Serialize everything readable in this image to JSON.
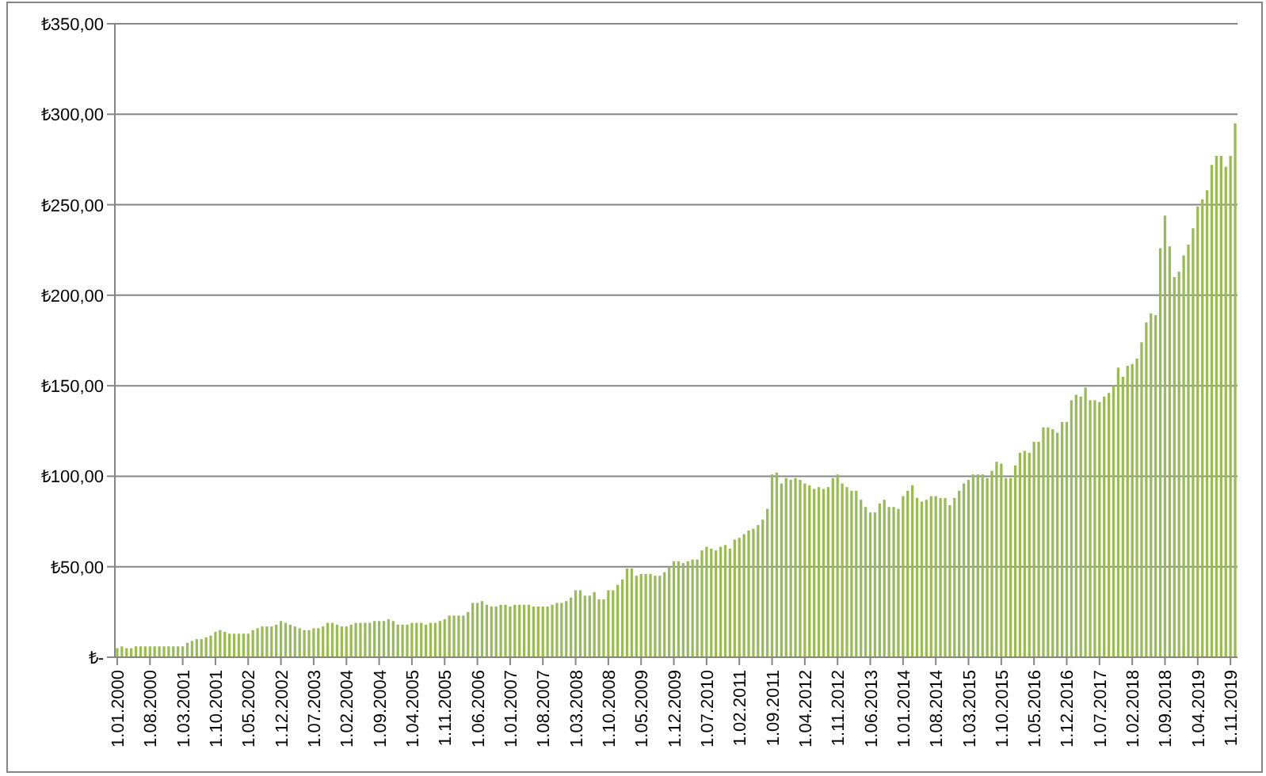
{
  "chart_data": {
    "type": "bar",
    "color": "#9bbb59",
    "yticks": [
      {
        "value": 0,
        "label": "₺-"
      },
      {
        "value": 50,
        "label": "₺50,00"
      },
      {
        "value": 100,
        "label": "₺100,00"
      },
      {
        "value": 150,
        "label": "₺150,00"
      },
      {
        "value": 200,
        "label": "₺200,00"
      },
      {
        "value": 250,
        "label": "₺250,00"
      },
      {
        "value": 300,
        "label": "₺300,00"
      },
      {
        "value": 350,
        "label": "₺350,00"
      }
    ],
    "ylim": [
      0,
      350
    ],
    "grid": true,
    "categories": [
      "1.01.2000",
      null,
      null,
      null,
      null,
      null,
      null,
      "1.08.2000",
      null,
      null,
      null,
      null,
      null,
      null,
      "1.03.2001",
      null,
      null,
      null,
      null,
      null,
      null,
      "1.10.2001",
      null,
      null,
      null,
      null,
      null,
      null,
      "1.05.2002",
      null,
      null,
      null,
      null,
      null,
      null,
      "1.12.2002",
      null,
      null,
      null,
      null,
      null,
      null,
      "1.07.2003",
      null,
      null,
      null,
      null,
      null,
      null,
      "1.02.2004",
      null,
      null,
      null,
      null,
      null,
      null,
      "1.09.2004",
      null,
      null,
      null,
      null,
      null,
      null,
      "1.04.2005",
      null,
      null,
      null,
      null,
      null,
      null,
      "1.11.2005",
      null,
      null,
      null,
      null,
      null,
      null,
      "1.06.2006",
      null,
      null,
      null,
      null,
      null,
      null,
      "1.01.2007",
      null,
      null,
      null,
      null,
      null,
      null,
      "1.08.2007",
      null,
      null,
      null,
      null,
      null,
      null,
      "1.03.2008",
      null,
      null,
      null,
      null,
      null,
      null,
      "1.10.2008",
      null,
      null,
      null,
      null,
      null,
      null,
      "1.05.2009",
      null,
      null,
      null,
      null,
      null,
      null,
      "1.12.2009",
      null,
      null,
      null,
      null,
      null,
      null,
      "1.07.2010",
      null,
      null,
      null,
      null,
      null,
      null,
      "1.02.2011",
      null,
      null,
      null,
      null,
      null,
      null,
      "1.09.2011",
      null,
      null,
      null,
      null,
      null,
      null,
      "1.04.2012",
      null,
      null,
      null,
      null,
      null,
      null,
      "1.11.2012",
      null,
      null,
      null,
      null,
      null,
      null,
      "1.06.2013",
      null,
      null,
      null,
      null,
      null,
      null,
      "1.01.2014",
      null,
      null,
      null,
      null,
      null,
      null,
      "1.08.2014",
      null,
      null,
      null,
      null,
      null,
      null,
      "1.03.2015",
      null,
      null,
      null,
      null,
      null,
      null,
      "1.10.2015",
      null,
      null,
      null,
      null,
      null,
      null,
      "1.05.2016",
      null,
      null,
      null,
      null,
      null,
      null,
      "1.12.2016",
      null,
      null,
      null,
      null,
      null,
      null,
      "1.07.2017",
      null,
      null,
      null,
      null,
      null,
      null,
      "1.02.2018",
      null,
      null,
      null,
      null,
      null,
      null,
      "1.09.2018",
      null,
      null,
      null,
      null,
      null,
      null,
      "1.04.2019",
      null,
      null,
      null,
      null,
      null,
      null,
      "1.11.2019",
      null
    ],
    "values": [
      5,
      6,
      5,
      5,
      6,
      6,
      6,
      6,
      6,
      6,
      6,
      6,
      6,
      6,
      6,
      8,
      9,
      10,
      10,
      11,
      12,
      14,
      15,
      14,
      13,
      13,
      13,
      13,
      13,
      15,
      16,
      17,
      17,
      17,
      18,
      20,
      19,
      18,
      17,
      16,
      15,
      15,
      16,
      16,
      17,
      19,
      19,
      18,
      17,
      17,
      18,
      19,
      19,
      19,
      19,
      20,
      20,
      20,
      21,
      20,
      18,
      18,
      18,
      19,
      19,
      19,
      18,
      19,
      19,
      20,
      21,
      23,
      23,
      23,
      23,
      25,
      30,
      30,
      31,
      29,
      28,
      28,
      29,
      29,
      28,
      29,
      29,
      29,
      29,
      28,
      28,
      28,
      28,
      29,
      30,
      30,
      31,
      33,
      37,
      37,
      34,
      34,
      36,
      32,
      32,
      37,
      37,
      40,
      43,
      49,
      49,
      45,
      46,
      46,
      46,
      45,
      45,
      47,
      50,
      53,
      53,
      52,
      53,
      54,
      54,
      59,
      61,
      60,
      59,
      61,
      62,
      60,
      65,
      66,
      68,
      70,
      71,
      73,
      76,
      82,
      101,
      102,
      96,
      99,
      98,
      99,
      98,
      96,
      95,
      93,
      94,
      93,
      94,
      99,
      101,
      96,
      94,
      92,
      92,
      87,
      83,
      80,
      80,
      85,
      87,
      83,
      83,
      82,
      89,
      92,
      95,
      88,
      86,
      87,
      89,
      89,
      88,
      88,
      84,
      88,
      92,
      96,
      98,
      101,
      101,
      101,
      99,
      103,
      108,
      107,
      99,
      99,
      106,
      113,
      114,
      113,
      119,
      119,
      127,
      127,
      126,
      124,
      130,
      130,
      142,
      145,
      144,
      149,
      142,
      142,
      141,
      144,
      146,
      150,
      160,
      155,
      161,
      162,
      165,
      174,
      185,
      190,
      189,
      226,
      244,
      227,
      210,
      213,
      222,
      228,
      237,
      249,
      253,
      258,
      272,
      277,
      277,
      271,
      277,
      295
    ]
  }
}
